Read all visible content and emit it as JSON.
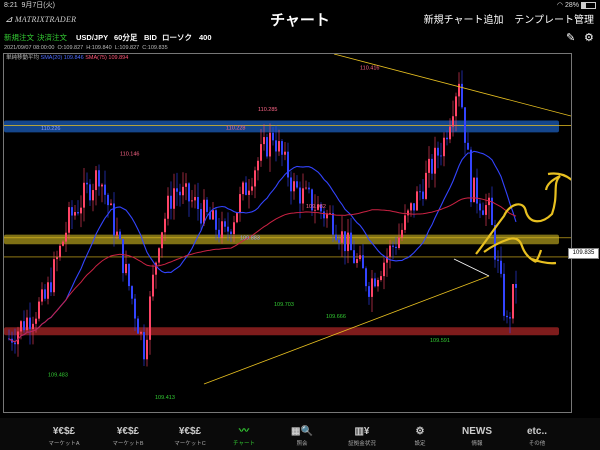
{
  "status_bar": {
    "time": "8:21",
    "date": "9月7日(火)",
    "battery": "28%",
    "battery_level": 0.28
  },
  "nav": {
    "logo": "MATRIXTRADER",
    "title": "チャート",
    "add_chart": "新規チャート追加",
    "template": "テンプレート管理"
  },
  "toolbar": {
    "new_order": "新規注文",
    "settle_order": "決済注文",
    "pair": "USD/JPY",
    "interval": "60分足",
    "side": "BID",
    "chart_type": "ローソク",
    "count": "400",
    "draw_icon": "pencil-icon",
    "settings_icon": "gear-icon"
  },
  "ohlc": {
    "datetime": "2021/09/07 08:00:00",
    "open": "O:109.827",
    "high": "H:109.840",
    "low": "L:109.827",
    "close": "C:109.835"
  },
  "indicator": {
    "name": "単純移動平均",
    "sma_short": "SMA(20) 109.846",
    "sma_long": "SMA(75) 109.894",
    "sma_short_color": "#3344ff",
    "sma_long_color": "#cc2244"
  },
  "chart_data": {
    "type": "candlestick",
    "annotations": [
      "110.416",
      "110.285",
      "110.228",
      "110.226",
      "110.146",
      "109.982",
      "109.883",
      "109.703",
      "109.666",
      "109.591",
      "109.483",
      "109.413"
    ],
    "current_price": "109.835",
    "zones": [
      {
        "name": "resistance",
        "color": "#1e64c8"
      },
      {
        "name": "middle",
        "color": "#b4a01e"
      },
      {
        "name": "support",
        "color": "#b42828"
      }
    ],
    "colors": {
      "up": "#ff4466",
      "down": "#3344ff",
      "sma20": "#3344ff",
      "sma75": "#cc2244",
      "drawing": "#e8c020"
    }
  },
  "tabs": [
    {
      "icon": "¥€$£",
      "label": "マーケットA"
    },
    {
      "icon": "¥€$£",
      "label": "マーケットB"
    },
    {
      "icon": "¥€$£",
      "label": "マーケットC"
    },
    {
      "icon": "〰",
      "label": "チャート"
    },
    {
      "icon": "▦🔍",
      "label": "照会"
    },
    {
      "icon": "▥¥",
      "label": "証拠金状況"
    },
    {
      "icon": "⚙",
      "label": "設定"
    },
    {
      "icon": "NEWS",
      "label": "情報"
    },
    {
      "icon": "etc..",
      "label": "その他"
    }
  ]
}
